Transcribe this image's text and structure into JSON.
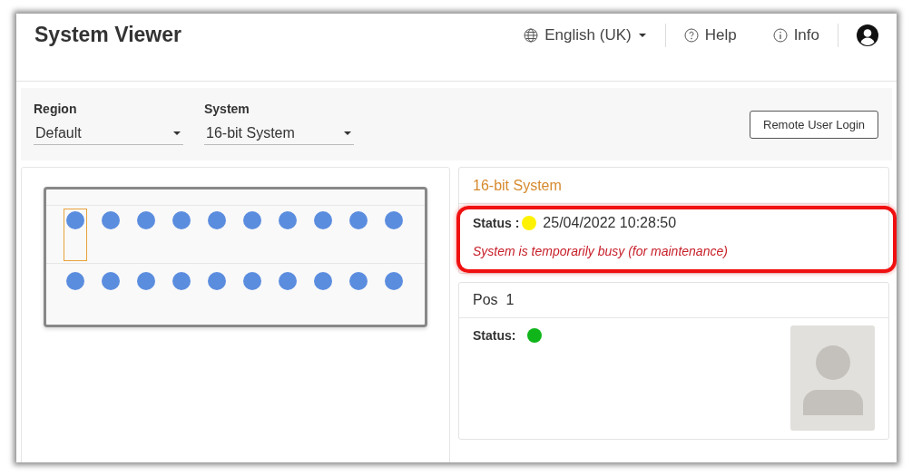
{
  "header": {
    "title": "System Viewer",
    "language": "English (UK)",
    "help": "Help",
    "info": "Info"
  },
  "filters": [
    {
      "label": "Region",
      "value": "Default"
    },
    {
      "label": "System",
      "value": "16-bit System"
    }
  ],
  "remote_login_button": "Remote User Login",
  "rack": {
    "rows": [
      {
        "slots": [
          {
            "selected": true
          },
          {
            "selected": false
          },
          {
            "selected": false
          },
          {
            "selected": false
          },
          {
            "selected": false
          },
          {
            "selected": false
          },
          {
            "selected": false
          },
          {
            "selected": false
          },
          {
            "selected": false
          },
          {
            "selected": false
          }
        ]
      },
      {
        "slots": [
          {
            "selected": false
          },
          {
            "selected": false
          },
          {
            "selected": false
          },
          {
            "selected": false
          },
          {
            "selected": false
          },
          {
            "selected": false
          },
          {
            "selected": false
          },
          {
            "selected": false
          },
          {
            "selected": false
          },
          {
            "selected": false
          }
        ]
      }
    ]
  },
  "system_panel": {
    "title": "16-bit System",
    "status_label": "Status :",
    "status_dot": {
      "color": "#fff200"
    },
    "timestamp": "25/04/2022 10:28:50",
    "message": "System is temporarily busy (for maintenance)",
    "highlighted": true
  },
  "position_panel": {
    "title": "Pos  1",
    "status_label": "Status:",
    "status_dot": {
      "color": "#10b51a"
    }
  }
}
